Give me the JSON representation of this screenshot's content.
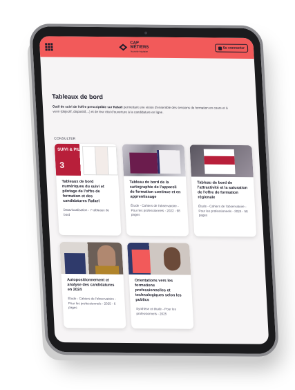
{
  "header": {
    "brand_line1": "CAP",
    "brand_line2": "MÉTIERS",
    "brand_tagline": "Nouvelle-Aquitaine",
    "connect_label": "Se connecter"
  },
  "page": {
    "title": "Tableaux de bord",
    "intro_bold": "Outil de suivi de l'offre prescriptible sur Rafael",
    "intro_rest": " permettant une vision d'ensemble des sessions de formation en cours et à venir (objectif, dispositif,...) et de leur état d'ouverture à la candidature en ligne.",
    "section_label": "CONSULTER"
  },
  "cards": [
    {
      "title": "Tableaux de bord numériques du suivi et pilotage de l'offre de formation et des candidatures Rafael",
      "meta": "Datavisualisation - 7 tableaux de bord",
      "thumb_text_1": "SUIVI & PILOTAGE",
      "thumb_text_2": "3"
    },
    {
      "title": "Tableau de bord de la cartographie de l'appareil de formation continue et en apprentissage",
      "meta": "Étude - Cahiers de l'observatoire - Pour les professionnels - 2022 - 98 pages"
    },
    {
      "title": "Tableau de bord de l'attractivité et la saturation de l'offre de formation régionale",
      "meta": "Étude - Cahiers de l'observatoire - Pour les professionnels - 2024 - 58 pages"
    },
    {
      "title": "Autopositionnement et analyse des candidatures en 2024",
      "meta": "Étude - Cahiers de l'observatoire - Pour les professionnels - 2025 - 6 pages"
    },
    {
      "title": "Orientations vers les formations professionnelles et technologiques selon les publics",
      "meta": "Synthèse et étude - Pour les professionnels - 2025"
    }
  ]
}
